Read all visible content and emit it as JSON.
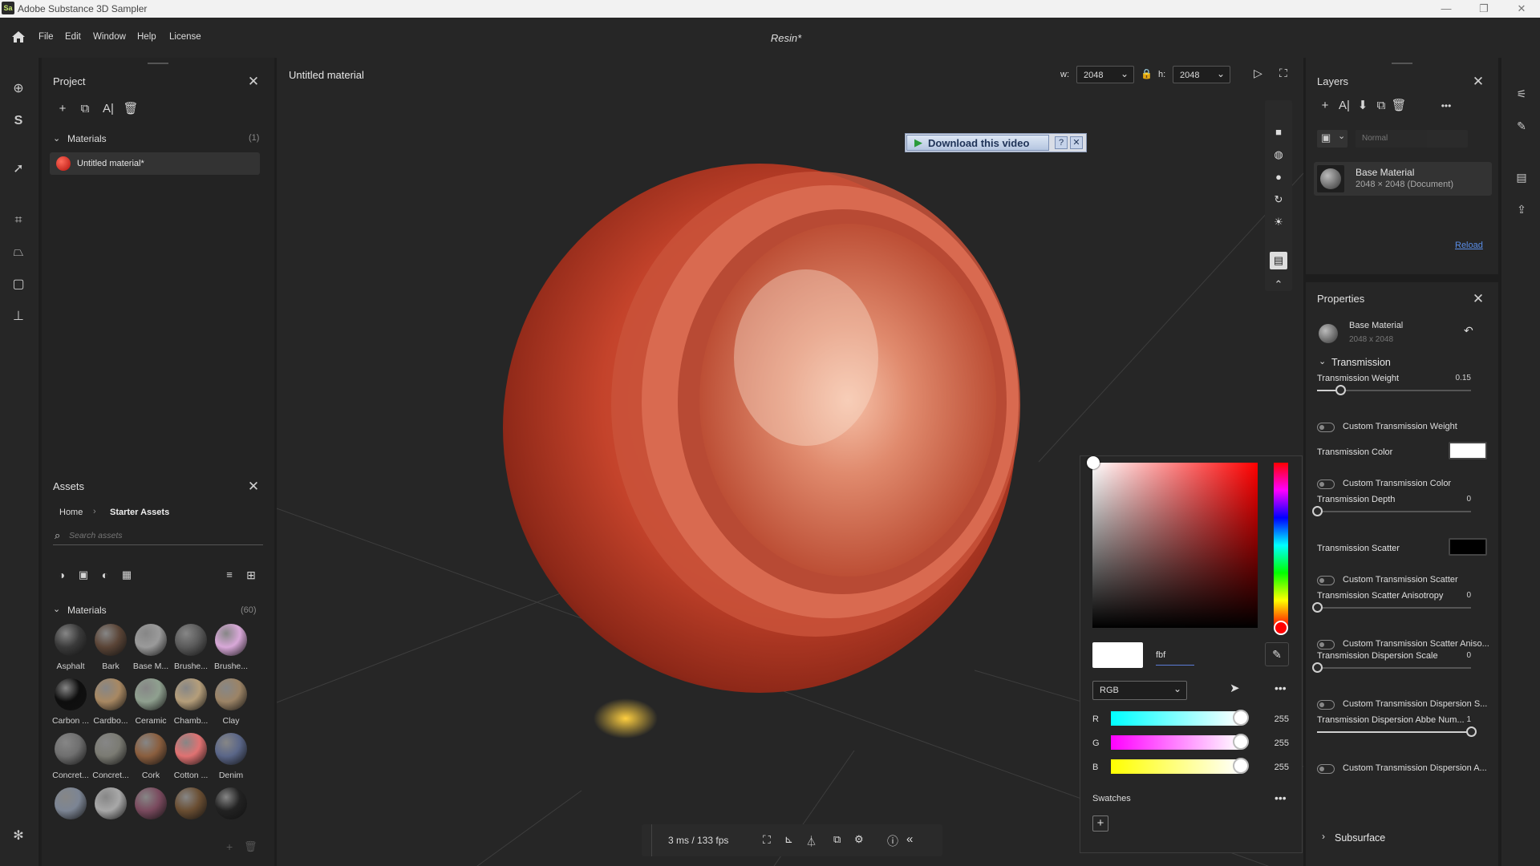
{
  "app": {
    "title": "Adobe Substance 3D Sampler",
    "logo_text": "Sa",
    "document": "Resin*"
  },
  "menu": [
    "File",
    "Edit",
    "Window",
    "Help",
    "License"
  ],
  "window_controls": {
    "minimize": "—",
    "maximize": "❐",
    "close": "✕"
  },
  "project": {
    "title": "Project",
    "section": "Materials",
    "count": "(1)",
    "item": "Untitled material*",
    "item_color": "#d9231f"
  },
  "assets": {
    "title": "Assets",
    "breadcrumb": [
      "Home",
      "Starter Assets"
    ],
    "search_placeholder": "Search assets",
    "section": "Materials",
    "count": "(60)",
    "items": [
      {
        "label": "Asphalt",
        "color": "#3a3a3a"
      },
      {
        "label": "Bark",
        "color": "#5a4436"
      },
      {
        "label": "Base M...",
        "color": "#9a9a9a"
      },
      {
        "label": "Brushe...",
        "color": "#5a5a5a"
      },
      {
        "label": "Brushe...",
        "color": "#d8a8d8"
      },
      {
        "label": "Carbon ...",
        "color": "#0e0e0e"
      },
      {
        "label": "Cardbo...",
        "color": "#a88862"
      },
      {
        "label": "Ceramic",
        "color": "#8fa08f"
      },
      {
        "label": "Chamb...",
        "color": "#b59e7a"
      },
      {
        "label": "Clay",
        "color": "#9c8466"
      },
      {
        "label": "Concret...",
        "color": "#6f6f6f"
      },
      {
        "label": "Concret...",
        "color": "#7b7b73"
      },
      {
        "label": "Cork",
        "color": "#8a5e3e"
      },
      {
        "label": "Cotton ...",
        "color": "#e07272"
      },
      {
        "label": "Denim",
        "color": "#5a6688"
      },
      {
        "label": "",
        "color": "#7c8594"
      },
      {
        "label": "",
        "color": "#a8a8a8"
      },
      {
        "label": "",
        "color": "#7a4a5e"
      },
      {
        "label": "",
        "color": "#6a4e32"
      },
      {
        "label": "",
        "color": "#222222"
      }
    ]
  },
  "viewport": {
    "title": "Untitled material",
    "w_label": "w:",
    "w_value": "2048",
    "h_label": "h:",
    "h_value": "2048",
    "download_banner": "Download this video",
    "status": "3 ms / 133 fps"
  },
  "layers": {
    "title": "Layers",
    "blend": "Normal",
    "layer_name": "Base Material",
    "layer_size": "2048 × 2048 (Document)",
    "reload": "Reload"
  },
  "properties": {
    "title": "Properties",
    "material": "Base Material",
    "size": "2048 x 2048",
    "section": "Transmission",
    "rows": [
      {
        "type": "slider",
        "label": "Transmission Weight",
        "value": "0.15",
        "fraction": 0.15
      },
      {
        "type": "toggle",
        "label": "Custom Transmission Weight"
      },
      {
        "type": "color",
        "label": "Transmission Color",
        "color": "#ffffff"
      },
      {
        "type": "toggle",
        "label": "Custom Transmission Color"
      },
      {
        "type": "slider",
        "label": "Transmission Depth",
        "value": "0",
        "fraction": 0
      },
      {
        "type": "color",
        "label": "Transmission Scatter",
        "color": "#000000"
      },
      {
        "type": "toggle",
        "label": "Custom Transmission Scatter"
      },
      {
        "type": "slider",
        "label": "Transmission Scatter Anisotropy",
        "value": "0",
        "fraction": 0
      },
      {
        "type": "toggle",
        "label": "Custom Transmission Scatter Aniso..."
      },
      {
        "type": "slider",
        "label": "Transmission Dispersion Scale",
        "value": "0",
        "fraction": 0
      },
      {
        "type": "toggle",
        "label": "Custom Transmission Dispersion S..."
      },
      {
        "type": "slider",
        "label": "Transmission Dispersion Abbe Num...",
        "value": "1",
        "fraction": 1
      },
      {
        "type": "toggle",
        "label": "Custom Transmission Dispersion A..."
      }
    ],
    "collapsed_section": "Subsurface"
  },
  "color_picker": {
    "hex": "fbf",
    "mode": "RGB",
    "channels": [
      {
        "label": "R",
        "value": "255"
      },
      {
        "label": "G",
        "value": "255"
      },
      {
        "label": "B",
        "value": "255"
      }
    ],
    "swatches_label": "Swatches"
  }
}
